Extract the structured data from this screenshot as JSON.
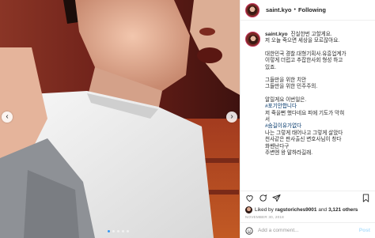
{
  "header": {
    "username": "saint.kyo",
    "separator": "•",
    "follow_label": "Following"
  },
  "caption": {
    "username": "saint.kyo",
    "lines": [
      "진실한번 고할게요.",
      "저 오늘 죽으면 세상을 모르잖아요.",
      "",
      "대한민국 경찰.대형기획사.유흥업계가",
      "이렇게 더럽고 추잡한사회 형성 하고",
      "있죠.",
      "",
      "그들만을 위한 치안",
      "그들만을 위한 민주주의.",
      "",
      "알릴게요 이번일은.",
      "#포기안합니다",
      "저 죽을뻔 했다네요 피에 기도가 막혀",
      "서",
      "#숨길이유가없다",
      "나는 그렇게 태어나고 그렇게 살았다",
      "천사같은 판사출신 변호사님이 창다",
      "화벤난다구",
      "주변엔 왕 말하라길래."
    ]
  },
  "actions": {
    "icons": [
      "heart-icon",
      "comment-icon",
      "share-icon",
      "bookmark-icon"
    ]
  },
  "likes": {
    "prefix": "Liked by",
    "user": "ragstoriches9001",
    "conjunction": "and",
    "others": "3,121 others"
  },
  "date": "NOVEMBER 30, 2018",
  "add_comment": {
    "placeholder": "Add a comment...",
    "post_label": "Post"
  },
  "carousel": {
    "dot_count": 5,
    "active_index": 0
  },
  "colors": {
    "accent_link": "#003569",
    "post_button_disabled": "#b2dffc",
    "active_dot": "#3897f0",
    "story_ring": "#c7365f"
  }
}
